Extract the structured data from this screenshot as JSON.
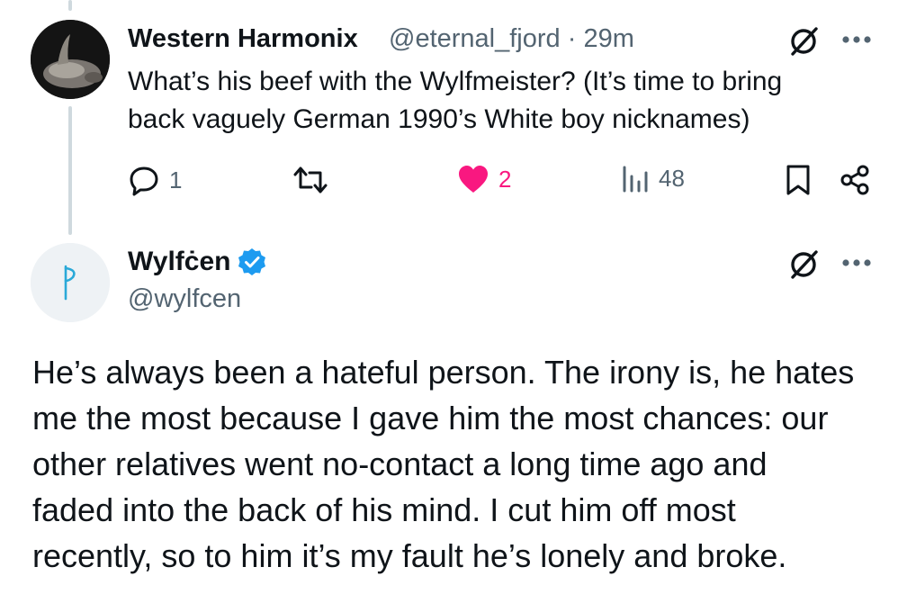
{
  "tweet1": {
    "display_name": "Western Harmonix",
    "handle": "@eternal_fjord",
    "separator": "·",
    "time": "29m",
    "text": "What’s his beef with the Wylfmeister? (It’s time to bring\nback vaguely German 1990’s White boy nicknames)",
    "actions": {
      "replies": "1",
      "reposts": "",
      "likes": "2",
      "views": "48"
    }
  },
  "tweet2": {
    "display_name": "Wylfċen",
    "handle": "@wylfcen",
    "verified": true,
    "text": "He’s always been a hateful person. The irony is, he hates\nme the most because I gave him the most chances: our\nother relatives went no-contact a long time ago and\nfaded into the back of his mind. I cut him off most\nrecently, so to him it’s my fault he’s lonely and broke."
  },
  "colors": {
    "text": "#0f1419",
    "muted": "#536471",
    "like": "#f91880",
    "verified": "#1d9bf0",
    "thread_line": "#cfd9de"
  },
  "icons": [
    "grok-icon",
    "more-icon",
    "reply-icon",
    "repost-icon",
    "heart-icon",
    "views-icon",
    "bookmark-icon",
    "share-icon",
    "verified-badge-icon"
  ]
}
